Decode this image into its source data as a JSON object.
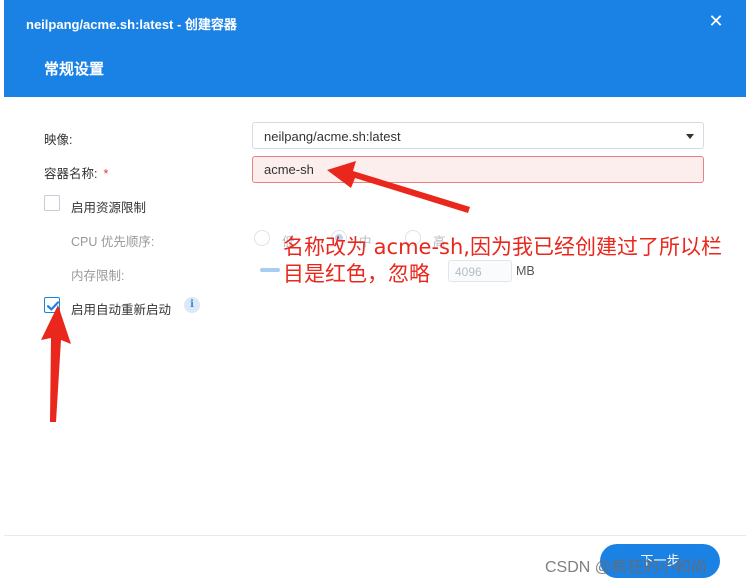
{
  "dialog": {
    "title": "neilpang/acme.sh:latest - 创建容器",
    "close_glyph": "✕",
    "tab_label": "常规设置"
  },
  "form": {
    "image_label": "映像:",
    "image_value": "neilpang/acme.sh:latest",
    "container_name_label": "容器名称:",
    "required_mark": "*",
    "container_name_value": "acme-sh",
    "resource_limit_label": "启用资源限制",
    "resource_limit_checked": false,
    "cpu_priority_label": "CPU 优先顺序:",
    "cpu_options": [
      "低",
      "中",
      "高"
    ],
    "cpu_selected": "中",
    "memory_limit_label": "内存限制:",
    "memory_value": "4096",
    "memory_unit": "MB",
    "auto_restart_label": "启用自动重新启动",
    "auto_restart_checked": true,
    "info_glyph": "i"
  },
  "footer": {
    "next_label": "下一步"
  },
  "annotation": {
    "text": "名称改为 acme-sh,因为我已经创建过了所以栏目是红色，忽略"
  },
  "watermark": "CSDN @疯狂的小和尚",
  "colors": {
    "accent": "#1b82e5",
    "error_border": "#e88282",
    "error_bg": "#fdeeee",
    "annotation": "#e9271c"
  },
  "icons": {
    "close": "close-icon",
    "dropdown": "chevron-down-icon",
    "checkmark": "checkmark-icon",
    "info": "info-icon"
  }
}
